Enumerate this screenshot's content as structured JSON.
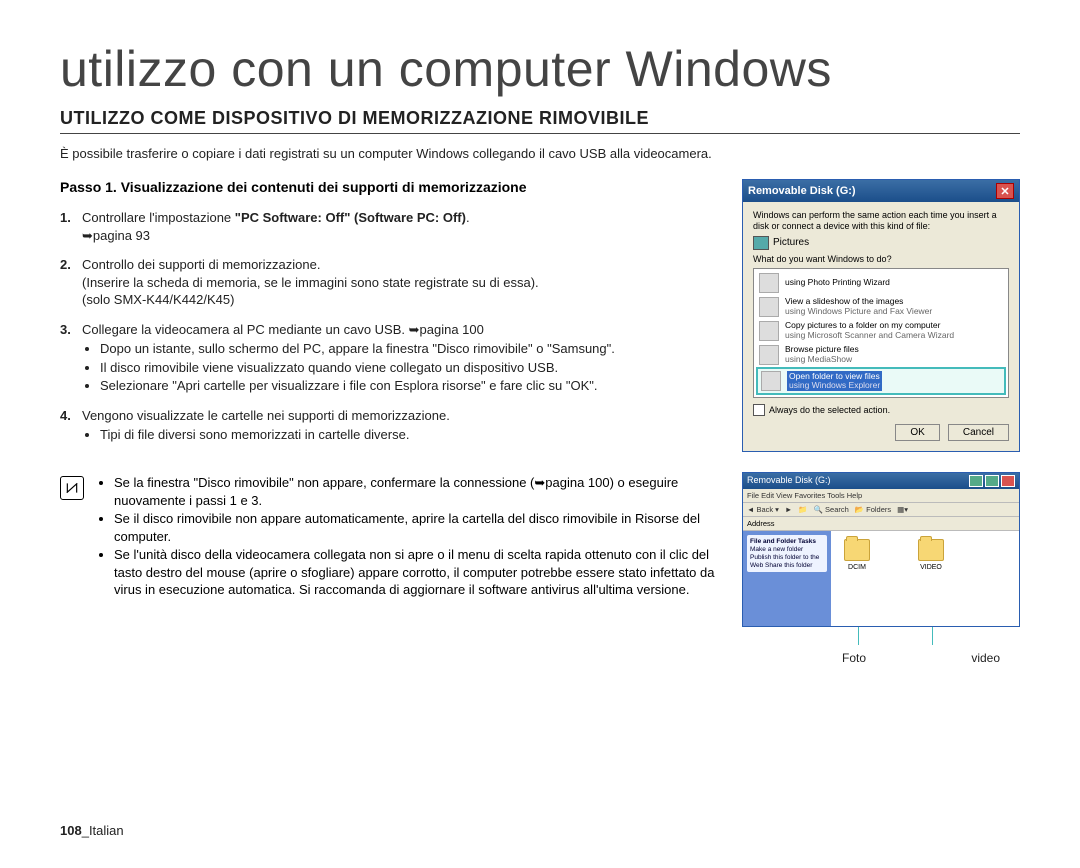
{
  "title": "utilizzo con un computer Windows",
  "section_heading": "UTILIZZO COME DISPOSITIVO DI MEMORIZZAZIONE RIMOVIBILE",
  "intro": "È possibile trasferire o copiare i dati registrati su un computer Windows collegando il cavo USB alla videocamera.",
  "step_heading": "Passo 1. Visualizzazione dei contenuti dei supporti di memorizzazione",
  "steps": {
    "s1": {
      "num": "1.",
      "text_a": "Controllare l'impostazione ",
      "bold": "\"PC Software: Off\" (Software PC: Off)",
      "text_b": ".",
      "ref": "➥pagina 93"
    },
    "s2": {
      "num": "2.",
      "text": "Controllo dei supporti di memorizzazione.",
      "sub1": "(Inserire la scheda di memoria, se le immagini sono state registrate su di essa).",
      "sub2": "(solo SMX-K44/K442/K45)"
    },
    "s3": {
      "num": "3.",
      "text": "Collegare la videocamera al PC mediante un cavo USB. ➥pagina 100",
      "b1": "Dopo un istante, sullo schermo del PC, appare la finestra \"Disco rimovibile\" o \"Samsung\".",
      "b2": "Il disco rimovibile viene visualizzato quando viene collegato un dispositivo USB.",
      "b3": "Selezionare \"Apri cartelle per visualizzare i file con Esplora risorse\" e fare clic su \"OK\"."
    },
    "s4": {
      "num": "4.",
      "text": "Vengono visualizzate le cartelle nei supporti di memorizzazione.",
      "b1": "Tipi di file diversi sono memorizzati in cartelle diverse."
    }
  },
  "notes": {
    "n1": "Se la finestra \"Disco rimovibile\" non appare, confermare la connessione (➥pagina 100) o eseguire nuovamente i passi 1 e 3.",
    "n2": "Se il disco rimovibile non appare automaticamente, aprire la cartella del disco rimovibile in Risorse del computer.",
    "n3": "Se l'unità disco della videocamera collegata non si apre o il menu di scelta rapida ottenuto con il clic del tasto destro del mouse (aprire o sfogliare) appare corrotto, il computer potrebbe essere stato infettato da virus in esecuzione automatica. Si raccomanda di aggiornare il software antivirus all'ultima versione."
  },
  "dialog": {
    "title": "Removable Disk (G:)",
    "msg": "Windows can perform the same action each time you insert a disk or connect a device with this kind of file:",
    "pictures": "Pictures",
    "question": "What do you want Windows to do?",
    "options": {
      "o1": {
        "t1": "using Photo Printing Wizard",
        "t2": ""
      },
      "o2": {
        "t1": "View a slideshow of the images",
        "t2": "using Windows Picture and Fax Viewer"
      },
      "o3": {
        "t1": "Copy pictures to a folder on my computer",
        "t2": "using Microsoft Scanner and Camera Wizard"
      },
      "o4": {
        "t1": "Browse picture files",
        "t2": "using MediaShow"
      },
      "o5": {
        "t1": "Open folder to view files",
        "t2": "using Windows Explorer"
      }
    },
    "checkbox": "Always do the selected action.",
    "ok": "OK",
    "cancel": "Cancel"
  },
  "explorer": {
    "title": "Removable Disk (G:)",
    "menu": "File  Edit  View  Favorites  Tools  Help",
    "back": "Back",
    "search": "Search",
    "folders_btn": "Folders",
    "address": "Address",
    "side_panel_title": "File and Folder Tasks",
    "side_panel_items": "Make a new folder\nPublish this folder to the Web\nShare this folder",
    "folder1": "DCIM",
    "folder2": "VIDEO"
  },
  "labels": {
    "foto": "Foto",
    "video": "video"
  },
  "footer": {
    "page": "108",
    "sep": "_",
    "lang": "Italian"
  }
}
